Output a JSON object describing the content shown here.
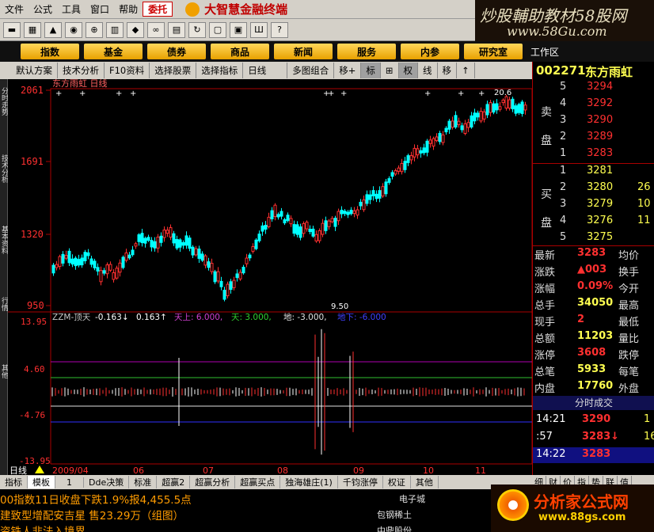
{
  "menubar": {
    "items": [
      "文件",
      "公式",
      "工具",
      "窗口",
      "帮助"
    ],
    "entrust_label": "委托",
    "app_title": "大智慧金融终端"
  },
  "brand": {
    "line1": "炒股輔助教材58股网",
    "line2": "www.58Gu.com",
    "workarea": "工作区"
  },
  "navbar": {
    "buttons": [
      "指数",
      "基金",
      "债券",
      "商品",
      "新闻",
      "服务",
      "内参",
      "研究室"
    ]
  },
  "subtoolbar": {
    "items": [
      "默认方案",
      "技术分析",
      "F10资料",
      "选择股票",
      "选择指标",
      "日线",
      "多图组合",
      "移+",
      "标",
      "⊞",
      "权",
      "线",
      "移",
      "↑"
    ]
  },
  "chart": {
    "title": "东方雨虹 日线",
    "price_labels": [
      "2061",
      "1691",
      "1320",
      "950"
    ],
    "high_annotation": "20.6",
    "low_annotation": "9.50",
    "indicator_title": "ZZM-顶天",
    "indicator_values": {
      "v1": "-0.163↓",
      "v2": "0.163↑",
      "v3": "天上: 6.000,",
      "v4": "天: 3.000,",
      "v5": "地: -3.000,",
      "v6": "地下: -6.000"
    },
    "indicator_labels": [
      "13.95",
      "4.60",
      "-4.76",
      "-13.95"
    ],
    "date_labels": [
      "2009/04",
      "06",
      "07",
      "08",
      "09",
      "10",
      "11"
    ],
    "period_label": "日线"
  },
  "left_sidebar": {
    "labels": [
      "分时走势",
      "技术分析",
      "基本资料",
      "行情",
      "其他"
    ]
  },
  "bottom_tabs": {
    "items": [
      "指标",
      "模板",
      "1",
      "Dde决策",
      "标准",
      "超赢2",
      "超赢分析",
      "超赢买点",
      "独海雄庄(1)",
      "千钧涨停",
      "权证",
      "其他"
    ]
  },
  "ticker": {
    "line1": "00指数11日收盘下跌1.9%报4,455.5点",
    "line2": "建致型增配安吉星 售23.29万（组图）",
    "line3": "资铁人非法入境界",
    "mid1": "电子城",
    "mid2": "包钢稀土",
    "mid3": "中鼎股份"
  },
  "quote": {
    "code": "002271",
    "name": "东方雨虹",
    "sell_label": [
      "卖",
      "盘"
    ],
    "buy_label": [
      "买",
      "盘"
    ],
    "asks": [
      {
        "level": "5",
        "price": "3294",
        "vol": ""
      },
      {
        "level": "4",
        "price": "3292",
        "vol": ""
      },
      {
        "level": "3",
        "price": "3290",
        "vol": ""
      },
      {
        "level": "2",
        "price": "3289",
        "vol": ""
      },
      {
        "level": "1",
        "price": "3283",
        "vol": ""
      }
    ],
    "bids": [
      {
        "level": "1",
        "price": "3281",
        "vol": ""
      },
      {
        "level": "2",
        "price": "3280",
        "vol": "26"
      },
      {
        "level": "3",
        "price": "3279",
        "vol": "10"
      },
      {
        "level": "4",
        "price": "3276",
        "vol": "11"
      },
      {
        "level": "5",
        "price": "3275",
        "vol": ""
      }
    ],
    "stats": [
      {
        "k": "最新",
        "v": "3283",
        "k2": "均价"
      },
      {
        "k": "涨跌",
        "v": "▲003",
        "k2": "换手"
      },
      {
        "k": "涨幅",
        "v": "0.09%",
        "k2": "今开"
      },
      {
        "k": "总手",
        "v": "34050",
        "k2": "最高"
      },
      {
        "k": "现手",
        "v": "2",
        "k2": "最低"
      },
      {
        "k": "总额",
        "v": "11203",
        "k2": "量比"
      },
      {
        "k": "涨停",
        "v": "3608",
        "k2": "跌停"
      },
      {
        "k": "总笔",
        "v": "5933",
        "k2": "每笔"
      },
      {
        "k": "内盘",
        "v": "17760",
        "k2": "外盘"
      }
    ],
    "ticks_title": "分时成交",
    "ticks": [
      {
        "t": "14:21",
        "p": "3290",
        "v": "1"
      },
      {
        "t": ":57",
        "p": "3283↓",
        "v": "16"
      },
      {
        "t": "14:22",
        "p": "3283",
        "v": ""
      }
    ],
    "bottom_tabs": [
      "细",
      "财",
      "价",
      "指",
      "势",
      "联",
      "值"
    ]
  },
  "logo": {
    "text": "分析家公式网",
    "url": "www.88gs.com"
  },
  "colors": {
    "up": "#ff3030",
    "down": "#00ffff",
    "grid": "#aa0000",
    "nav": "#ffc020"
  }
}
